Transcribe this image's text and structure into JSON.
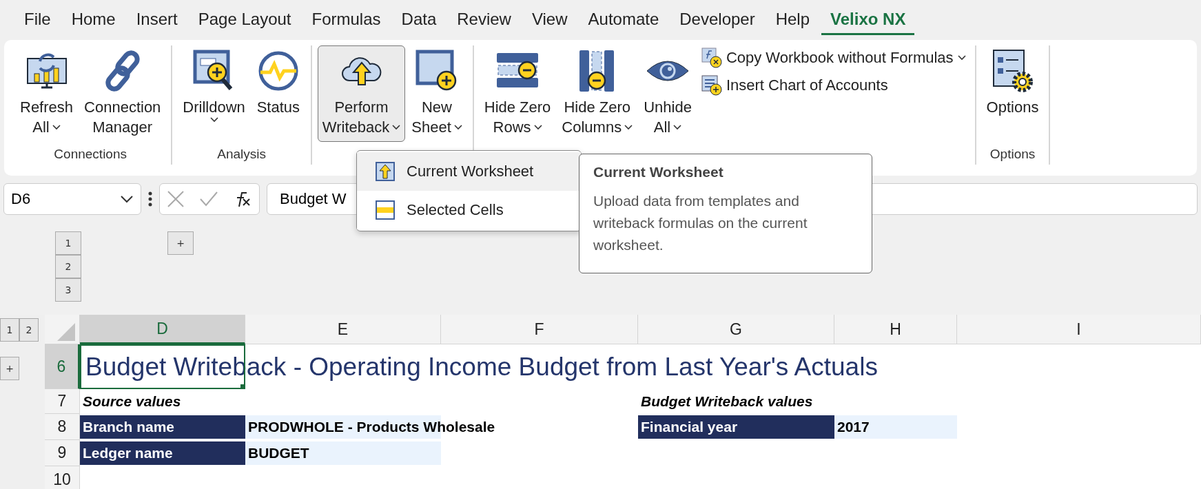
{
  "menu_tabs": [
    {
      "label": "File",
      "selected": false
    },
    {
      "label": "Home",
      "selected": false
    },
    {
      "label": "Insert",
      "selected": false
    },
    {
      "label": "Page Layout",
      "selected": false
    },
    {
      "label": "Formulas",
      "selected": false
    },
    {
      "label": "Data",
      "selected": false
    },
    {
      "label": "Review",
      "selected": false
    },
    {
      "label": "View",
      "selected": false
    },
    {
      "label": "Automate",
      "selected": false
    },
    {
      "label": "Developer",
      "selected": false
    },
    {
      "label": "Help",
      "selected": false
    },
    {
      "label": "Velixo NX",
      "selected": true
    }
  ],
  "ribbon": {
    "groups": [
      {
        "label": "Connections",
        "buttons": [
          {
            "kind": "large",
            "lines": [
              "Refresh",
              "All"
            ],
            "dropdown": true,
            "selected": false
          },
          {
            "kind": "large",
            "lines": [
              "Connection",
              "Manager"
            ],
            "dropdown": false,
            "selected": false
          }
        ]
      },
      {
        "label": "Analysis",
        "buttons": [
          {
            "kind": "large",
            "lines": [
              "Drilldown"
            ],
            "dropdown": true,
            "selected": false
          },
          {
            "kind": "large",
            "lines": [
              "Status"
            ],
            "dropdown": false,
            "selected": false
          }
        ]
      },
      {
        "buttons": [
          {
            "kind": "large",
            "lines": [
              "Perform",
              "Writeback"
            ],
            "dropdown": true,
            "selected": true
          },
          {
            "kind": "large",
            "lines": [
              "New",
              "Sheet"
            ],
            "dropdown": true,
            "selected": false
          }
        ]
      },
      {
        "buttons": [
          {
            "kind": "large",
            "lines": [
              "Hide Zero",
              "Rows"
            ],
            "dropdown": true,
            "selected": false
          },
          {
            "kind": "large",
            "lines": [
              "Hide Zero",
              "Columns"
            ],
            "dropdown": true,
            "selected": false
          },
          {
            "kind": "large",
            "lines": [
              "Unhide",
              "All"
            ],
            "dropdown": true,
            "selected": false
          },
          {
            "kind": "small",
            "lines": [
              "Copy Workbook without Formulas"
            ],
            "dropdown": true,
            "selected": false
          },
          {
            "kind": "small",
            "lines": [
              "Insert Chart of Accounts"
            ],
            "dropdown": false,
            "selected": false
          }
        ]
      },
      {
        "label": "Options",
        "buttons": [
          {
            "kind": "large",
            "lines": [
              "Options"
            ],
            "dropdown": false,
            "selected": false
          }
        ]
      }
    ]
  },
  "dropdown_menu": {
    "items": [
      {
        "label": "Current Worksheet",
        "selected": true
      },
      {
        "label": "Selected Cells",
        "selected": false
      }
    ]
  },
  "tooltip": {
    "title": "Current Worksheet",
    "text": "Upload data from templates and writeback formulas on the current worksheet."
  },
  "formula_bar": {
    "name_box": "D6",
    "formula": "Budget W"
  },
  "outline": {
    "row_levels": [
      "1",
      "2",
      "3"
    ],
    "column_levels": [
      "1",
      "2"
    ],
    "expand_buttons": [
      "+",
      "+"
    ]
  },
  "sheet": {
    "columns": [
      {
        "label": "D",
        "selected": true
      },
      {
        "label": "E",
        "selected": false
      },
      {
        "label": "F",
        "selected": false
      },
      {
        "label": "G",
        "selected": false
      },
      {
        "label": "H",
        "selected": false
      },
      {
        "label": "I",
        "selected": false
      }
    ],
    "rows": [
      {
        "label": "6",
        "selected": true
      },
      {
        "label": "7",
        "selected": false
      },
      {
        "label": "8",
        "selected": false
      },
      {
        "label": "9",
        "selected": false
      },
      {
        "label": "10",
        "selected": false
      }
    ],
    "title": "Budget Writeback - Operating Income Budget from Last Year's Actuals",
    "source": {
      "heading": "Source values",
      "fields": [
        {
          "label": "Branch name",
          "value": "PRODWHOLE - Products Wholesale"
        },
        {
          "label": "Ledger name",
          "value": "BUDGET"
        }
      ]
    },
    "writeback": {
      "heading": "Budget Writeback values",
      "fields": [
        {
          "label": "Financial year",
          "value": "2017"
        }
      ]
    }
  }
}
